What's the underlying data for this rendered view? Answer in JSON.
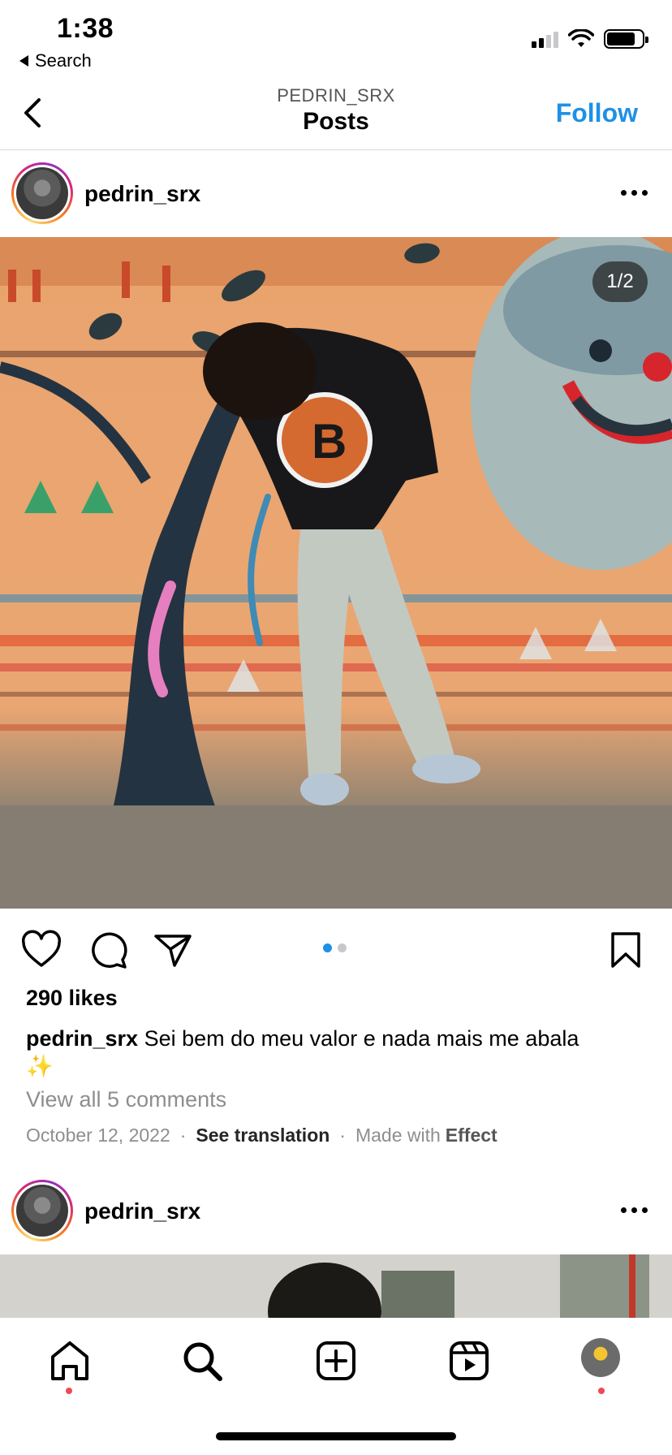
{
  "status_bar": {
    "time": "1:38",
    "back_app_label": "Search"
  },
  "nav": {
    "subtitle": "PEDRIN_SRX",
    "title": "Posts",
    "follow_label": "Follow"
  },
  "post": {
    "username": "pedrin_srx",
    "image_counter": "1/2",
    "carousel": {
      "total": 2,
      "active_index": 0
    },
    "likes": "290 likes",
    "caption_user": "pedrin_srx",
    "caption_text": "Sei bem do meu valor e nada mais me abala",
    "caption_emoji": "✨",
    "view_comments": "View all 5 comments",
    "date": "October 12, 2022",
    "see_translation": "See translation",
    "made_with_prefix": "Made with",
    "effect": "Effect"
  },
  "next_post": {
    "username": "pedrin_srx"
  },
  "tab_bar": {
    "items": [
      {
        "name": "home",
        "icon": "home-icon",
        "notification": true
      },
      {
        "name": "search",
        "icon": "search-icon",
        "notification": false
      },
      {
        "name": "create",
        "icon": "plus-square-icon",
        "notification": false
      },
      {
        "name": "reels",
        "icon": "reels-icon",
        "notification": false
      },
      {
        "name": "profile",
        "icon": "avatar",
        "notification": true
      }
    ]
  },
  "colors": {
    "accent": "#1f90e6",
    "notification": "#ed4956",
    "muted": "#8e8e8e"
  }
}
